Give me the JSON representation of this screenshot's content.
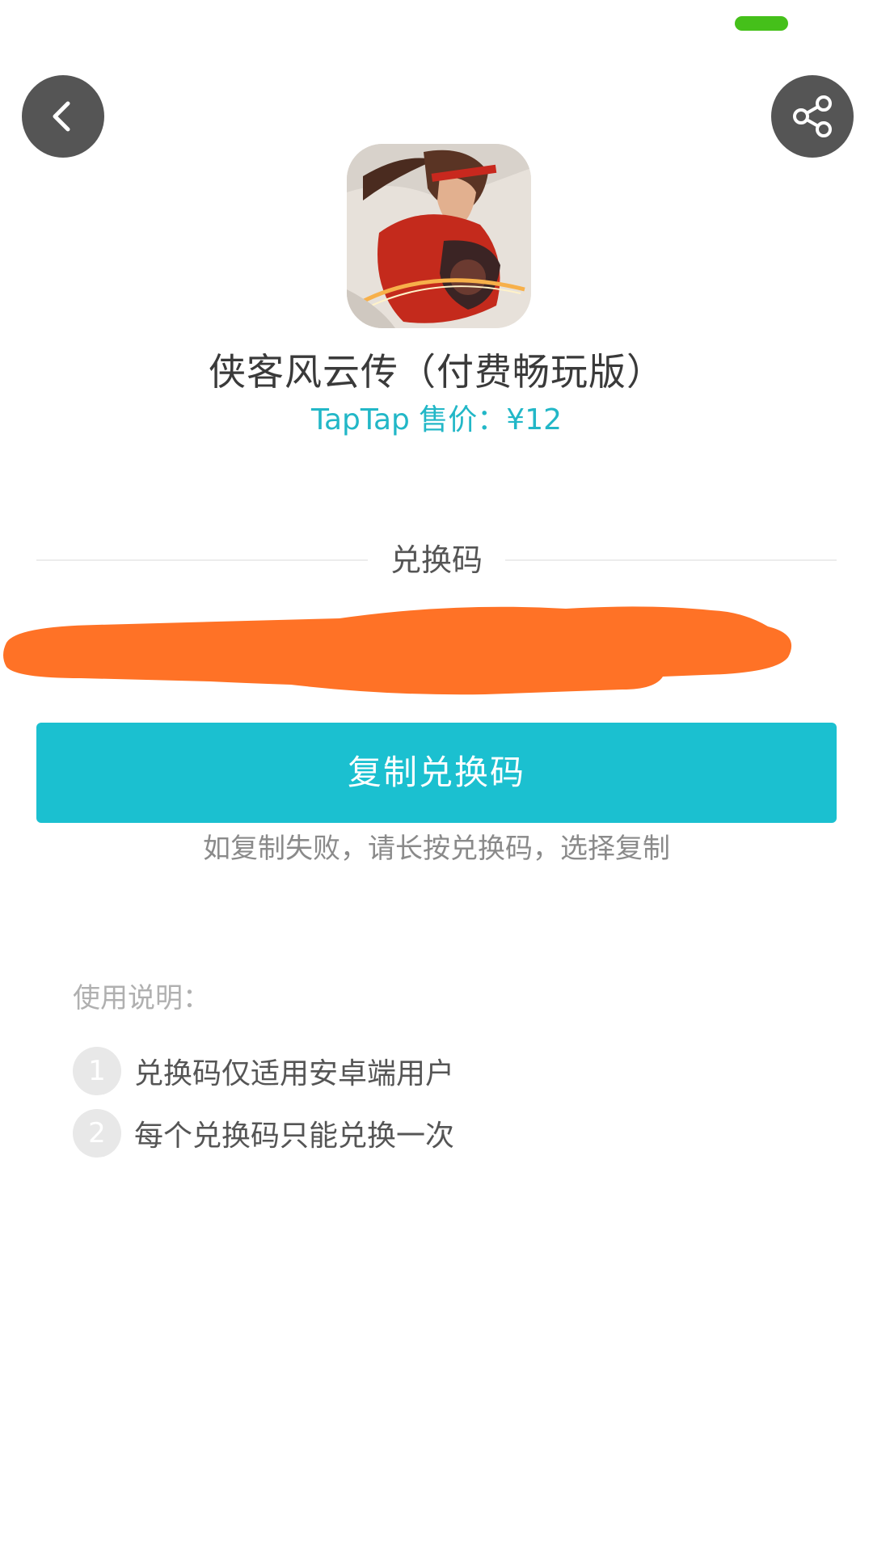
{
  "status_bar": {
    "indicator_color": "#45c01a"
  },
  "header": {
    "back_icon": "chevron-left-icon",
    "share_icon": "share-icon",
    "button_color": "#555555"
  },
  "app": {
    "icon": "game-app-icon",
    "title": "侠客风云传（付费畅玩版）",
    "price": "TapTap 售价：¥12"
  },
  "redeem": {
    "section_label": "兑换码",
    "code_value": "",
    "code_redacted": true,
    "redaction_color": "#ff7226",
    "copy_button_label": "复制兑换码",
    "copy_hint": "如复制失败，请长按兑换码，选择复制",
    "accent_color": "#1bc0d0"
  },
  "instructions": {
    "title": "使用说明：",
    "items": [
      {
        "number": "1",
        "text": "兑换码仅适用安卓端用户"
      },
      {
        "number": "2",
        "text": "每个兑换码只能兑换一次"
      }
    ]
  }
}
